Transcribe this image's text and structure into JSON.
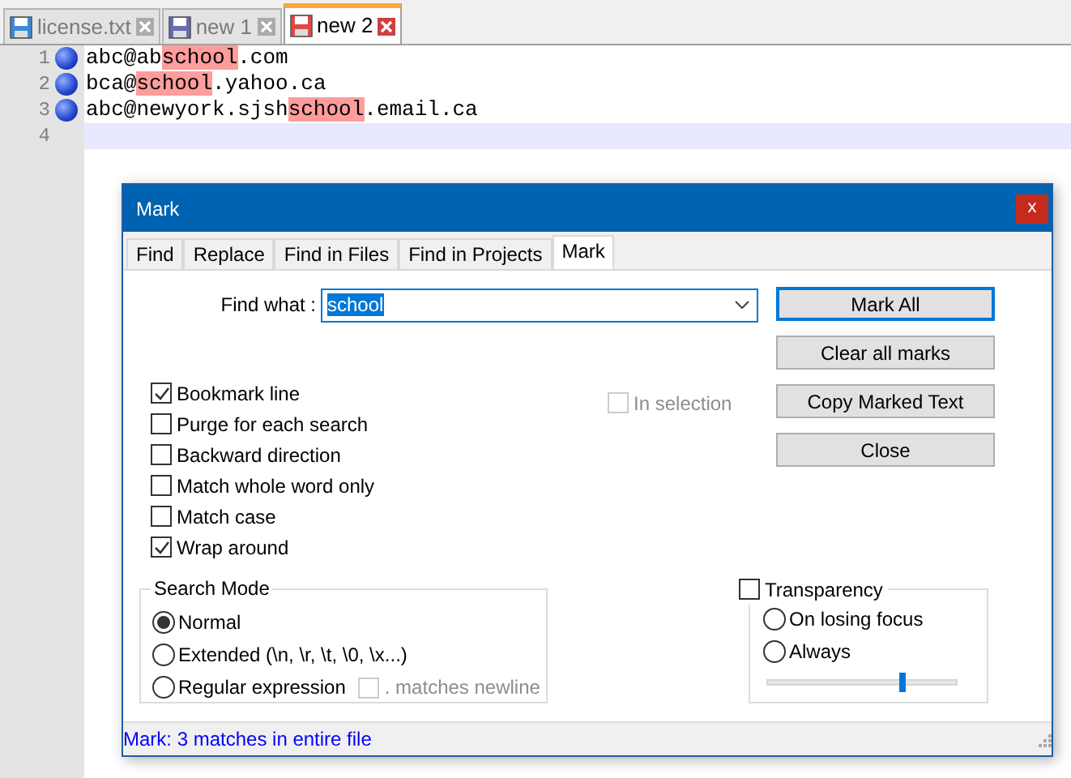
{
  "file_tabs": [
    {
      "label": "license.txt",
      "color": "#3a8ad8",
      "selected": false
    },
    {
      "label": "new 1",
      "color": "#6a6ab0",
      "selected": false
    },
    {
      "label": "new 2",
      "color": "#e04848",
      "selected": true
    }
  ],
  "editor": {
    "lines": [
      {
        "number": "1",
        "bookmarked": true,
        "current": false,
        "segments": [
          {
            "text": "abc@ab",
            "marked": false
          },
          {
            "text": "school",
            "marked": true
          },
          {
            "text": ".com",
            "marked": false
          }
        ]
      },
      {
        "number": "2",
        "bookmarked": true,
        "current": false,
        "segments": [
          {
            "text": "bca@",
            "marked": false
          },
          {
            "text": "school",
            "marked": true
          },
          {
            "text": ".yahoo.ca",
            "marked": false
          }
        ]
      },
      {
        "number": "3",
        "bookmarked": true,
        "current": false,
        "segments": [
          {
            "text": "abc@newyork.sjsh",
            "marked": false
          },
          {
            "text": "school",
            "marked": true
          },
          {
            "text": ".email.ca",
            "marked": false
          }
        ]
      },
      {
        "number": "4",
        "bookmarked": false,
        "current": true
      }
    ]
  },
  "dialog": {
    "title": "Mark",
    "close": "x",
    "tabs": [
      {
        "label": "Find",
        "selected": false
      },
      {
        "label": "Replace",
        "selected": false
      },
      {
        "label": "Find in Files",
        "selected": false
      },
      {
        "label": "Find in Projects",
        "selected": false
      },
      {
        "label": "Mark",
        "selected": true
      }
    ],
    "find_what": {
      "label": "Find what :",
      "value": "school"
    },
    "buttons": [
      {
        "label": "Mark All",
        "default": true
      },
      {
        "label": "Clear all marks",
        "default": false
      },
      {
        "label": "Copy Marked Text",
        "default": false
      },
      {
        "label": "Close",
        "default": false
      }
    ],
    "in_selection": {
      "label": "In selection",
      "checked": false,
      "disabled": true
    },
    "options": [
      {
        "label": "Bookmark line",
        "checked": true
      },
      {
        "label": "Purge for each search",
        "checked": false
      },
      {
        "label": "Backward direction",
        "checked": false
      },
      {
        "label": "Match whole word only",
        "checked": false
      },
      {
        "label": "Match case",
        "checked": false
      },
      {
        "label": "Wrap around",
        "checked": true
      }
    ],
    "search_mode": {
      "title": "Search Mode",
      "modes": [
        {
          "label": "Normal",
          "selected": true
        },
        {
          "label": "Extended (\\n, \\r, \\t, \\0, \\x...)",
          "selected": false
        },
        {
          "label": "Regular expression",
          "selected": false
        }
      ],
      "matches_newline": {
        "label": ". matches newline",
        "checked": false,
        "disabled": true
      }
    },
    "transparency": {
      "label": "Transparency",
      "checked": false,
      "modes": [
        {
          "label": "On losing focus",
          "selected": false
        },
        {
          "label": "Always",
          "selected": false
        }
      ],
      "level": 0.71
    },
    "status": "Mark: 3 matches in entire file"
  }
}
